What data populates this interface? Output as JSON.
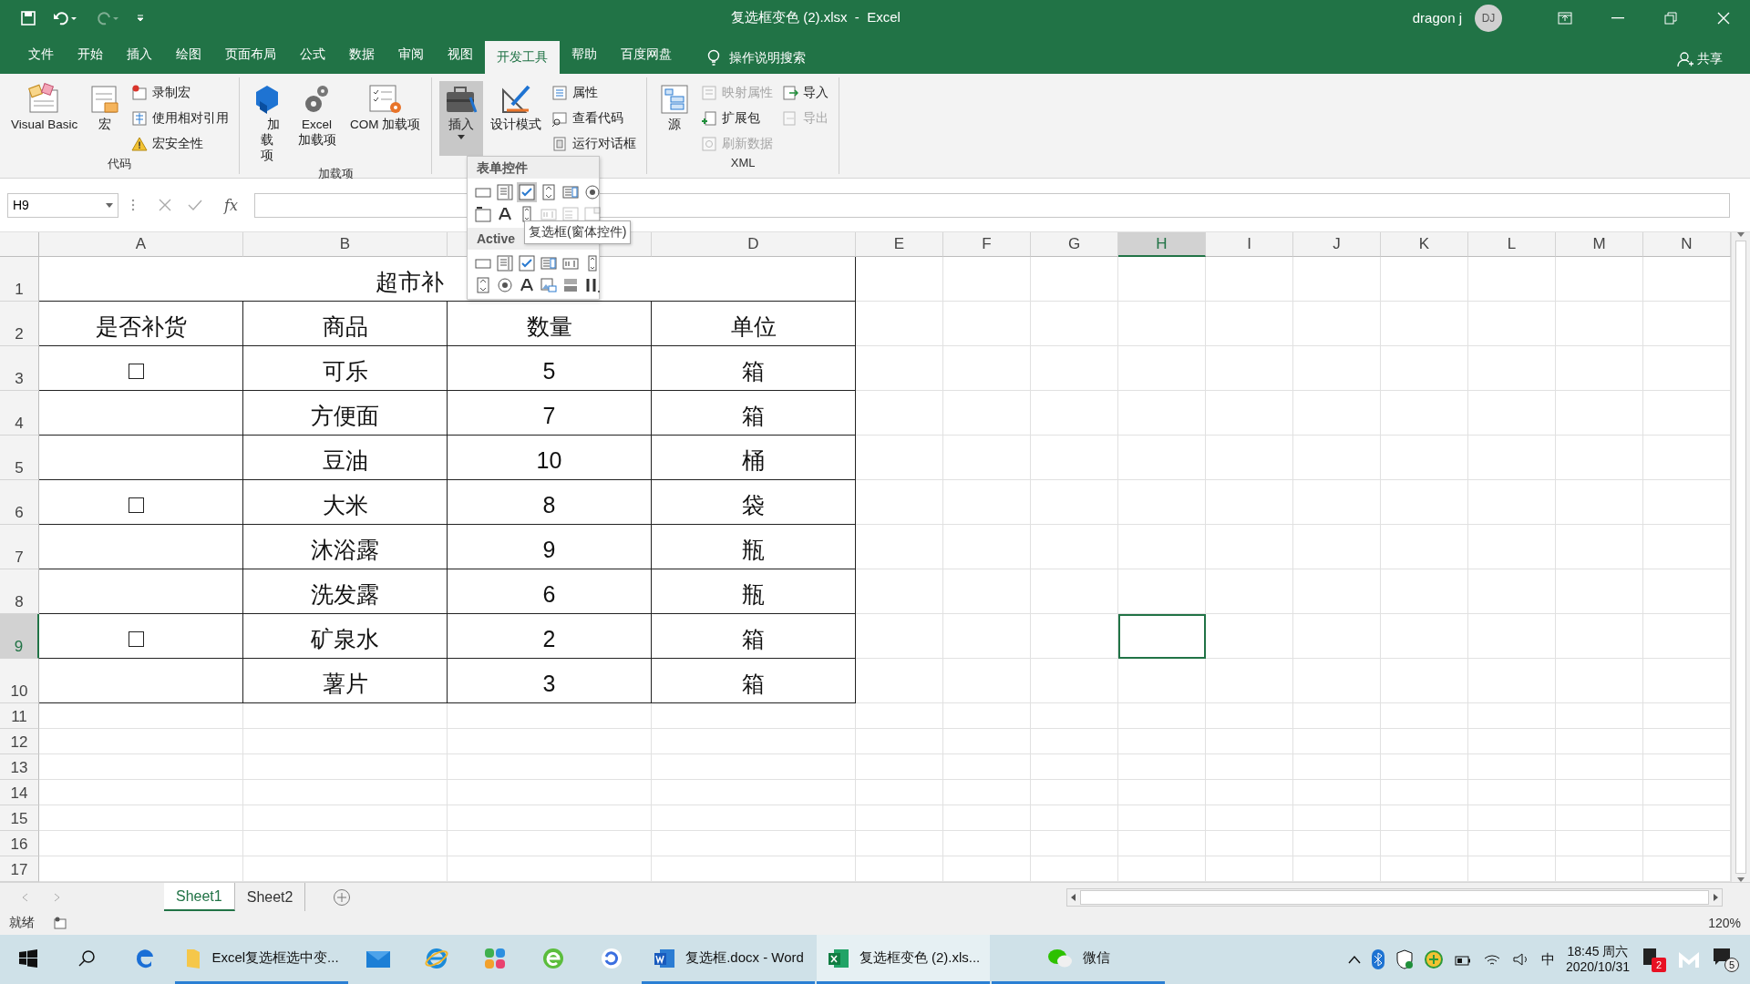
{
  "title_bar": {
    "title": "复选框变色 (2).xlsx  -  Excel",
    "user": "dragon j",
    "avatar": "DJ"
  },
  "menu_tabs": [
    {
      "label": "文件",
      "selected": false
    },
    {
      "label": "开始",
      "selected": false
    },
    {
      "label": "插入",
      "selected": false
    },
    {
      "label": "绘图",
      "selected": false
    },
    {
      "label": "页面布局",
      "selected": false
    },
    {
      "label": "公式",
      "selected": false
    },
    {
      "label": "数据",
      "selected": false
    },
    {
      "label": "审阅",
      "selected": false
    },
    {
      "label": "视图",
      "selected": false
    },
    {
      "label": "开发工具",
      "selected": true
    },
    {
      "label": "帮助",
      "selected": false
    },
    {
      "label": "百度网盘",
      "selected": false
    }
  ],
  "tell_me": "操作说明搜索",
  "share": "共享",
  "ribbon_groups": [
    {
      "label": "代码",
      "items": [
        {
          "kind": "large",
          "label": "Visual Basic",
          "disabled": false,
          "pressed": false
        },
        {
          "kind": "large",
          "label": "宏",
          "disabled": false,
          "pressed": false
        },
        {
          "kind": "stack",
          "items": [
            {
              "label": "录制宏",
              "disabled": false
            },
            {
              "label": "使用相对引用",
              "disabled": false
            },
            {
              "label": "宏安全性",
              "disabled": false
            }
          ]
        }
      ]
    },
    {
      "label": "加载项",
      "items": [
        {
          "kind": "large",
          "label": "加载项",
          "disabled": false,
          "pressed": false
        },
        {
          "kind": "large",
          "label": "Excel 加载项",
          "disabled": false,
          "pressed": false
        },
        {
          "kind": "large",
          "label": "COM 加载项",
          "disabled": false,
          "pressed": false
        }
      ]
    },
    {
      "items": [
        {
          "kind": "large",
          "label": "插入",
          "disabled": false,
          "pressed": true,
          "menu": true
        },
        {
          "kind": "large",
          "label": "设计模式",
          "disabled": false,
          "pressed": false
        },
        {
          "kind": "stack",
          "items": [
            {
              "label": "属性",
              "disabled": false
            },
            {
              "label": "查看代码",
              "disabled": false
            },
            {
              "label": "运行对话框",
              "disabled": false
            }
          ]
        }
      ]
    },
    {
      "label": "XML",
      "items": [
        {
          "kind": "large",
          "label": "源",
          "disabled": false,
          "pressed": false
        },
        {
          "kind": "stack",
          "items": [
            {
              "label": "映射属性",
              "disabled": true
            },
            {
              "label": "扩展包",
              "disabled": false
            },
            {
              "label": "刷新数据",
              "disabled": true
            }
          ]
        },
        {
          "kind": "stack",
          "items": [
            {
              "label": "导入",
              "disabled": false
            },
            {
              "label": "导出",
              "disabled": true
            }
          ]
        }
      ]
    }
  ],
  "insert_gallery": {
    "sections": [
      {
        "title": "表单控件",
        "controls": [
          {
            "kind": "button",
            "highlighted": false,
            "disabled": false
          },
          {
            "kind": "combo",
            "highlighted": false,
            "disabled": false
          },
          {
            "kind": "checkbox",
            "highlighted": true,
            "disabled": false
          },
          {
            "kind": "spin",
            "highlighted": false,
            "disabled": false
          },
          {
            "kind": "listbox",
            "highlighted": false,
            "disabled": false
          },
          {
            "kind": "option",
            "highlighted": false,
            "disabled": false
          },
          {
            "kind": "groupbox",
            "highlighted": false,
            "disabled": false
          },
          {
            "kind": "label",
            "highlighted": false,
            "disabled": false
          },
          {
            "kind": "scroll",
            "highlighted": false,
            "disabled": false
          },
          {
            "kind": "textfield",
            "highlighted": false,
            "disabled": true
          },
          {
            "kind": "combolist",
            "highlighted": false,
            "disabled": true
          },
          {
            "kind": "combodrop",
            "highlighted": false,
            "disabled": true
          }
        ]
      },
      {
        "title": "Active",
        "controls": [
          {
            "kind": "button",
            "highlighted": false,
            "disabled": false
          },
          {
            "kind": "combo",
            "highlighted": false,
            "disabled": false
          },
          {
            "kind": "checkbox",
            "highlighted": false,
            "disabled": false
          },
          {
            "kind": "listbox",
            "highlighted": false,
            "disabled": false
          },
          {
            "kind": "textfield",
            "highlighted": false,
            "disabled": false
          },
          {
            "kind": "scroll",
            "highlighted": false,
            "disabled": false
          },
          {
            "kind": "spin",
            "highlighted": false,
            "disabled": false
          },
          {
            "kind": "option",
            "highlighted": false,
            "disabled": false
          },
          {
            "kind": "label",
            "highlighted": false,
            "disabled": false
          },
          {
            "kind": "image",
            "highlighted": false,
            "disabled": false
          },
          {
            "kind": "toggle",
            "highlighted": false,
            "disabled": false
          },
          {
            "kind": "more",
            "highlighted": false,
            "disabled": false
          }
        ]
      }
    ],
    "tooltip": "复选框(窗体控件)"
  },
  "formula_bar": {
    "name_box": "H9",
    "function_label": "fx"
  },
  "columns": [
    {
      "label": "A",
      "selected": false
    },
    {
      "label": "B",
      "selected": false
    },
    {
      "selected": false
    },
    {
      "label": "D",
      "selected": false
    },
    {
      "label": "E",
      "selected": false
    },
    {
      "label": "F",
      "selected": false
    },
    {
      "label": "G",
      "selected": false
    },
    {
      "label": "H",
      "selected": true
    },
    {
      "label": "I",
      "selected": false
    },
    {
      "label": "J",
      "selected": false
    },
    {
      "label": "K",
      "selected": false
    },
    {
      "label": "L",
      "selected": false
    },
    {
      "label": "M",
      "selected": false
    },
    {
      "label": "N",
      "selected": false
    }
  ],
  "rows": [
    {
      "label": "1",
      "selected": false
    },
    {
      "label": "2",
      "selected": false
    },
    {
      "label": "3",
      "selected": false
    },
    {
      "label": "4",
      "selected": false
    },
    {
      "label": "5",
      "selected": false
    },
    {
      "label": "6",
      "selected": false
    },
    {
      "label": "7",
      "selected": false
    },
    {
      "label": "8",
      "selected": false
    },
    {
      "label": "9",
      "selected": true
    },
    {
      "label": "10",
      "selected": false
    },
    {
      "label": "11",
      "selected": false
    },
    {
      "label": "12",
      "selected": false
    },
    {
      "label": "13",
      "selected": false
    },
    {
      "label": "14",
      "selected": false
    },
    {
      "label": "15",
      "selected": false
    },
    {
      "label": "16",
      "selected": false
    },
    {
      "label": "17",
      "selected": false
    }
  ],
  "table": {
    "title": "超市补",
    "header": [
      "是否补货",
      "商品",
      "数量",
      "单位"
    ],
    "items": [
      {
        "checkbox": true,
        "checked": false,
        "product": "可乐",
        "qty": "5",
        "unit": "箱"
      },
      {
        "checkbox": false,
        "product": "方便面",
        "qty": "7",
        "unit": "箱"
      },
      {
        "checkbox": false,
        "product": "豆油",
        "qty": "10",
        "unit": "桶"
      },
      {
        "checkbox": true,
        "checked": false,
        "product": "大米",
        "qty": "8",
        "unit": "袋"
      },
      {
        "checkbox": false,
        "product": "沐浴露",
        "qty": "9",
        "unit": "瓶"
      },
      {
        "checkbox": false,
        "product": "洗发露",
        "qty": "6",
        "unit": "瓶"
      },
      {
        "checkbox": true,
        "checked": false,
        "product": "矿泉水",
        "qty": "2",
        "unit": "箱"
      },
      {
        "checkbox": false,
        "product": "薯片",
        "qty": "3",
        "unit": "箱"
      }
    ]
  },
  "sheet_tabs": [
    {
      "label": "Sheet1",
      "selected": true
    },
    {
      "label": "Sheet2",
      "selected": false
    }
  ],
  "status": {
    "text": "就绪",
    "zoom": "120%"
  },
  "taskbar": {
    "apps": [
      {
        "kind": "edge",
        "active": false,
        "open": false
      },
      {
        "kind": "folder",
        "label": "Excel复选框选中变...",
        "active": false,
        "open": true
      },
      {
        "kind": "mail",
        "active": false,
        "open": false
      },
      {
        "kind": "ie",
        "active": false,
        "open": false
      },
      {
        "kind": "tiles",
        "active": false,
        "open": false
      },
      {
        "kind": "green-e",
        "active": false,
        "open": false
      },
      {
        "kind": "circle",
        "active": false,
        "open": false
      },
      {
        "kind": "word",
        "label": "复选框.docx - Word",
        "active": false,
        "open": true
      },
      {
        "kind": "excel",
        "label": "复选框变色 (2).xls...",
        "active": true,
        "open": true
      },
      {
        "kind": "wechat",
        "label": "微信",
        "active": false,
        "open": true
      }
    ],
    "ime": "中",
    "time": "18:45 周六",
    "date": "2020/10/31",
    "notification_badge": "2",
    "action_badge": "5"
  }
}
